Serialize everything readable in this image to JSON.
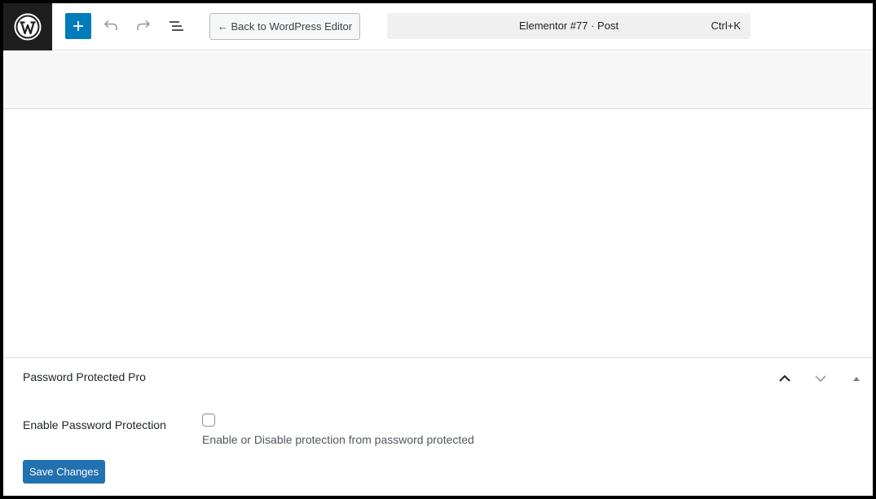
{
  "toolbar": {
    "logo_icon": "wordpress-logo-icon",
    "add_icon": "plus-icon",
    "undo_icon": "undo-icon",
    "redo_icon": "redo-icon",
    "document_overview_icon": "list-view-icon",
    "back_button_label": "← Back to WordPress Editor",
    "command_bar": {
      "title": "Elementor #77 · Post",
      "shortcut": "Ctrl+K"
    }
  },
  "metabox": {
    "title": "Password Protected Pro",
    "move_up_icon": "chevron-up-icon",
    "move_down_icon": "chevron-down-icon",
    "toggle_icon": "triangle-up-icon",
    "field": {
      "label": "Enable Password Protection",
      "checked": false,
      "description": "Enable or Disable protection from password protected"
    },
    "save_button_label": "Save Changes"
  },
  "colors": {
    "accent": "#007cba",
    "save_button": "#2271b1",
    "logo_background": "#1e1e1e",
    "band_background": "#f7f7f7"
  }
}
